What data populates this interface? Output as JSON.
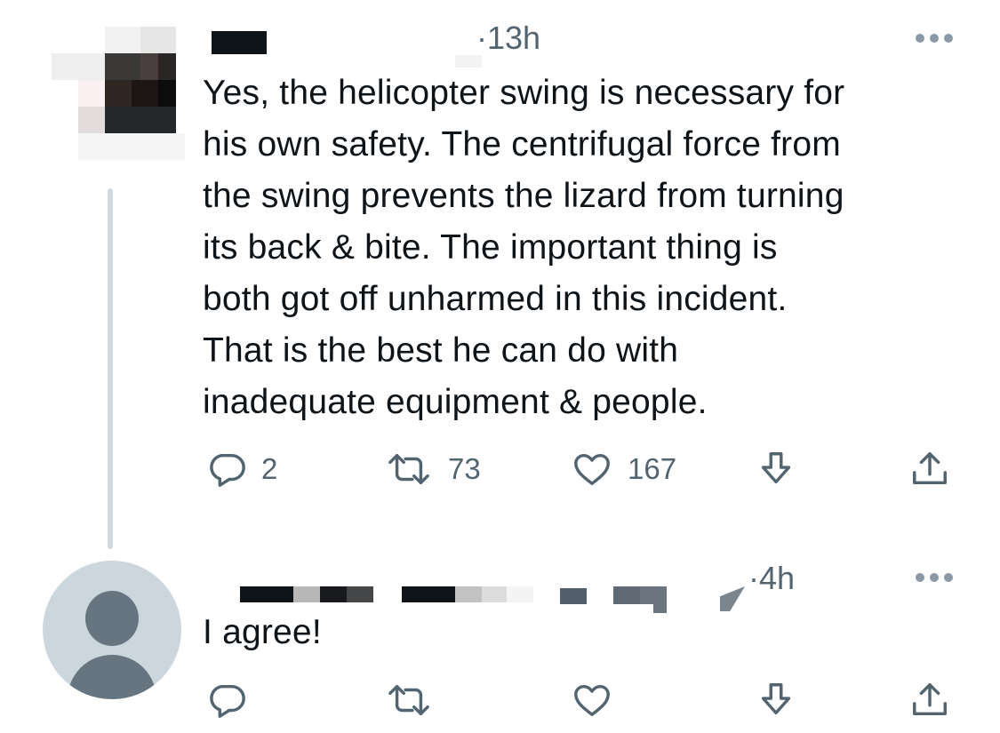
{
  "tweet1": {
    "time": "13h",
    "text": "Yes, the helicopter swing is necessary for his own safety. The centrifugal force from the swing prevents the lizard from turning its back & bite. The important thing is both got off unharmed in this incident. That is the best he can do with inadequate equipment & people.",
    "lines": [
      "Yes, the helicopter swing is necessary for",
      "his own safety. The centrifugal force from",
      "the swing prevents the lizard from turning",
      "its back & bite. The important thing is",
      "both got off unharmed in this incident.",
      "That is the best he can do with",
      "inadequate equipment & people."
    ],
    "replies": "2",
    "retweets": "73",
    "likes": "167"
  },
  "tweet2": {
    "time": "4h",
    "text": "I agree!"
  },
  "icons": {
    "reply": "reply-icon",
    "retweet": "retweet-icon",
    "like": "heart-icon",
    "bookmark": "bookmark-download-icon",
    "share": "share-icon",
    "more": "more-icon"
  },
  "colors": {
    "text": "#0f1419",
    "secondary": "#536471",
    "thread_line": "#cfd9de",
    "default_avatar_bg": "#ccd6dd",
    "default_avatar_fg": "#66757f"
  }
}
